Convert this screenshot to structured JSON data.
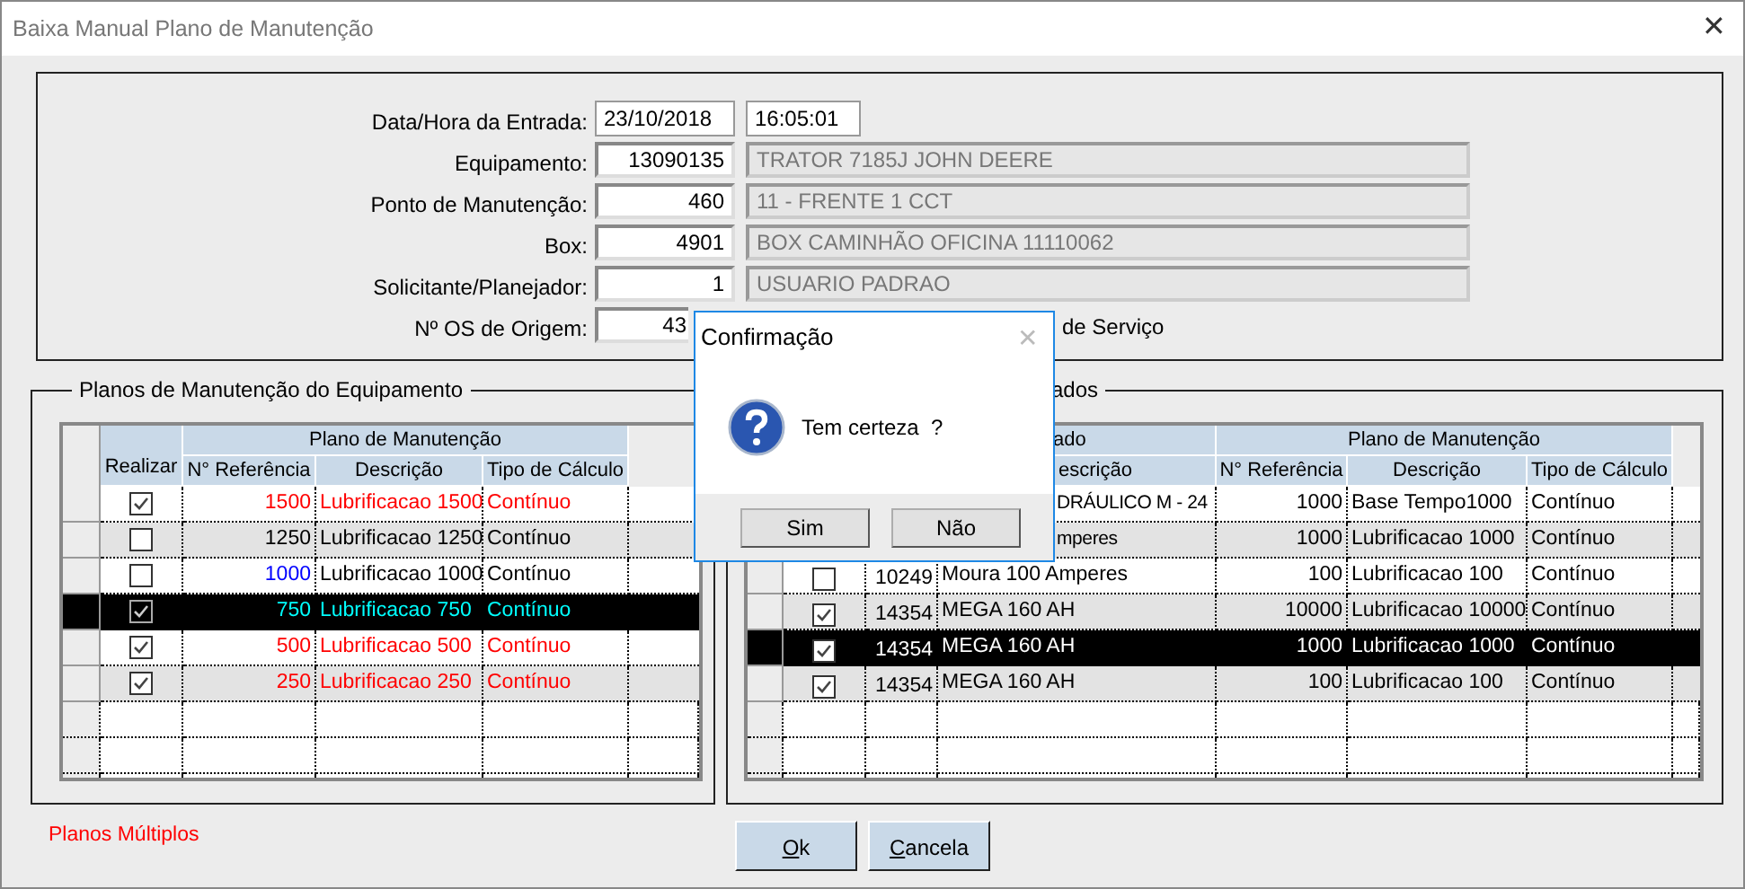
{
  "window": {
    "title": "Baixa Manual Plano de Manutenção",
    "close": "✕"
  },
  "header_fields": [
    {
      "label": "Data/Hora da Entrada:",
      "kind": "datetime",
      "value": "23/10/2018",
      "value2": "16:05:01"
    },
    {
      "label": "Equipamento:",
      "kind": "lookup",
      "value": "13090135",
      "description": "TRATOR 7185J JOHN DEERE"
    },
    {
      "label": "Ponto de Manutenção:",
      "kind": "lookup",
      "value": "460",
      "description": "11 - FRENTE 1 CCT"
    },
    {
      "label": "Box:",
      "kind": "lookup",
      "value": "4901",
      "description": "BOX CAMINHÃO OFICINA 11110062"
    },
    {
      "label": "Solicitante/Planejador:",
      "kind": "lookup",
      "value": "1",
      "description": "USUARIO PADRAO"
    },
    {
      "label": "Nº OS de Origem:",
      "kind": "partial",
      "value": "43",
      "trailing": "de Serviço"
    }
  ],
  "left_group": {
    "title": "Planos de Manutenção do Equipamento",
    "header_group": "Plano de Manutenção",
    "columns": [
      "Realizar",
      "N° Referência",
      "Descrição",
      "Tipo de Cálculo"
    ],
    "rows": [
      {
        "checked": true,
        "selected": false,
        "alert": true,
        "ref_marked": false,
        "ref": "1500",
        "description": "Lubrificacao 1500",
        "calc": "Contínuo"
      },
      {
        "checked": false,
        "selected": false,
        "alert": false,
        "ref_marked": false,
        "ref": "1250",
        "description": "Lubrificacao 1250",
        "calc": "Contínuo"
      },
      {
        "checked": false,
        "selected": false,
        "alert": false,
        "ref_marked": true,
        "ref": "1000",
        "description": "Lubrificacao 1000",
        "calc": "Contínuo"
      },
      {
        "checked": true,
        "selected": true,
        "ref": "750",
        "description": "Lubrificacao 750",
        "calc": "Contínuo"
      },
      {
        "checked": true,
        "selected": false,
        "alert": true,
        "ref_marked": false,
        "ref": "500",
        "description": "Lubrificacao 500",
        "calc": "Contínuo"
      },
      {
        "checked": true,
        "selected": false,
        "alert": true,
        "ref_marked": false,
        "ref": "250",
        "description": "Lubrificacao 250",
        "calc": "Contínuo"
      }
    ]
  },
  "right_group": {
    "title": "ados",
    "header_group_1": "ado",
    "header_group_2": "Plano de Manutenção",
    "columns": [
      "escrição",
      "N° Referência",
      "Descrição",
      "Tipo de Cálculo"
    ],
    "rows": [
      {
        "equipment": "DRÁULICO M - 24",
        "ref": "1000",
        "description": "Base Tempo1000",
        "calc": "Contínuo"
      },
      {
        "equipment": "mperes",
        "ref": "1000",
        "description": "Lubrificacao 1000",
        "calc": "Contínuo"
      },
      {
        "checked": false,
        "selected": false,
        "code": "10249",
        "equipment": "Moura 100 Amperes",
        "ref": "100",
        "description": "Lubrificacao 100",
        "calc": "Contínuo"
      },
      {
        "checked": true,
        "selected": false,
        "code": "14354",
        "equipment": "MEGA 160 AH",
        "ref": "10000",
        "description": "Lubrificacao 10000",
        "calc": "Contínuo"
      },
      {
        "checked": true,
        "selected": true,
        "code": "14354",
        "equipment": "MEGA 160 AH",
        "ref": "1000",
        "description": "Lubrificacao 1000",
        "calc": "Contínuo"
      },
      {
        "checked": true,
        "selected": false,
        "code": "14354",
        "equipment": "MEGA 160 AH",
        "ref": "100",
        "description": "Lubrificacao 100",
        "calc": "Contínuo"
      }
    ]
  },
  "footer_note": "Planos Múltiplos",
  "buttons": [
    {
      "label": "Ok"
    },
    {
      "label": "Cancela"
    }
  ],
  "dialog": {
    "title": "Confirmação",
    "close": "✕",
    "message": "Tem certeza  ?",
    "buttons": [
      "Sim",
      "Não"
    ]
  }
}
